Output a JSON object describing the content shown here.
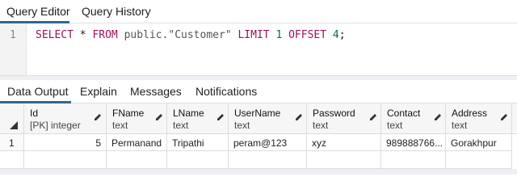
{
  "editor_tabs": [
    {
      "label": "Query Editor",
      "active": true
    },
    {
      "label": "Query History",
      "active": false
    }
  ],
  "editor": {
    "line_number": "1",
    "code": {
      "kw_select": "SELECT",
      "star": " * ",
      "kw_from": "FROM",
      "table": " public.\"Customer\" ",
      "kw_limit": "LIMIT",
      "limit_val": " 1 ",
      "kw_offset": "OFFSET",
      "offset_val": " 4",
      "end": ";"
    }
  },
  "result_tabs": [
    {
      "label": "Data Output",
      "active": true
    },
    {
      "label": "Explain",
      "active": false
    },
    {
      "label": "Messages",
      "active": false
    },
    {
      "label": "Notifications",
      "active": false
    }
  ],
  "grid": {
    "columns": [
      {
        "name": "Id",
        "type": "[PK] integer"
      },
      {
        "name": "FName",
        "type": "text"
      },
      {
        "name": "LName",
        "type": "text"
      },
      {
        "name": "UserName",
        "type": "text"
      },
      {
        "name": "Password",
        "type": "text"
      },
      {
        "name": "Contact",
        "type": "text"
      },
      {
        "name": "Address",
        "type": "text"
      }
    ],
    "rows": [
      {
        "row_num": "1",
        "cells": [
          "5",
          "Permanand",
          "Tripathi",
          "peram@123",
          "xyz",
          "989888766...",
          "Gorakhpur"
        ]
      }
    ]
  },
  "colors": {
    "accent": "#326690",
    "keyword": "#9b0f5e",
    "number": "#116644"
  }
}
